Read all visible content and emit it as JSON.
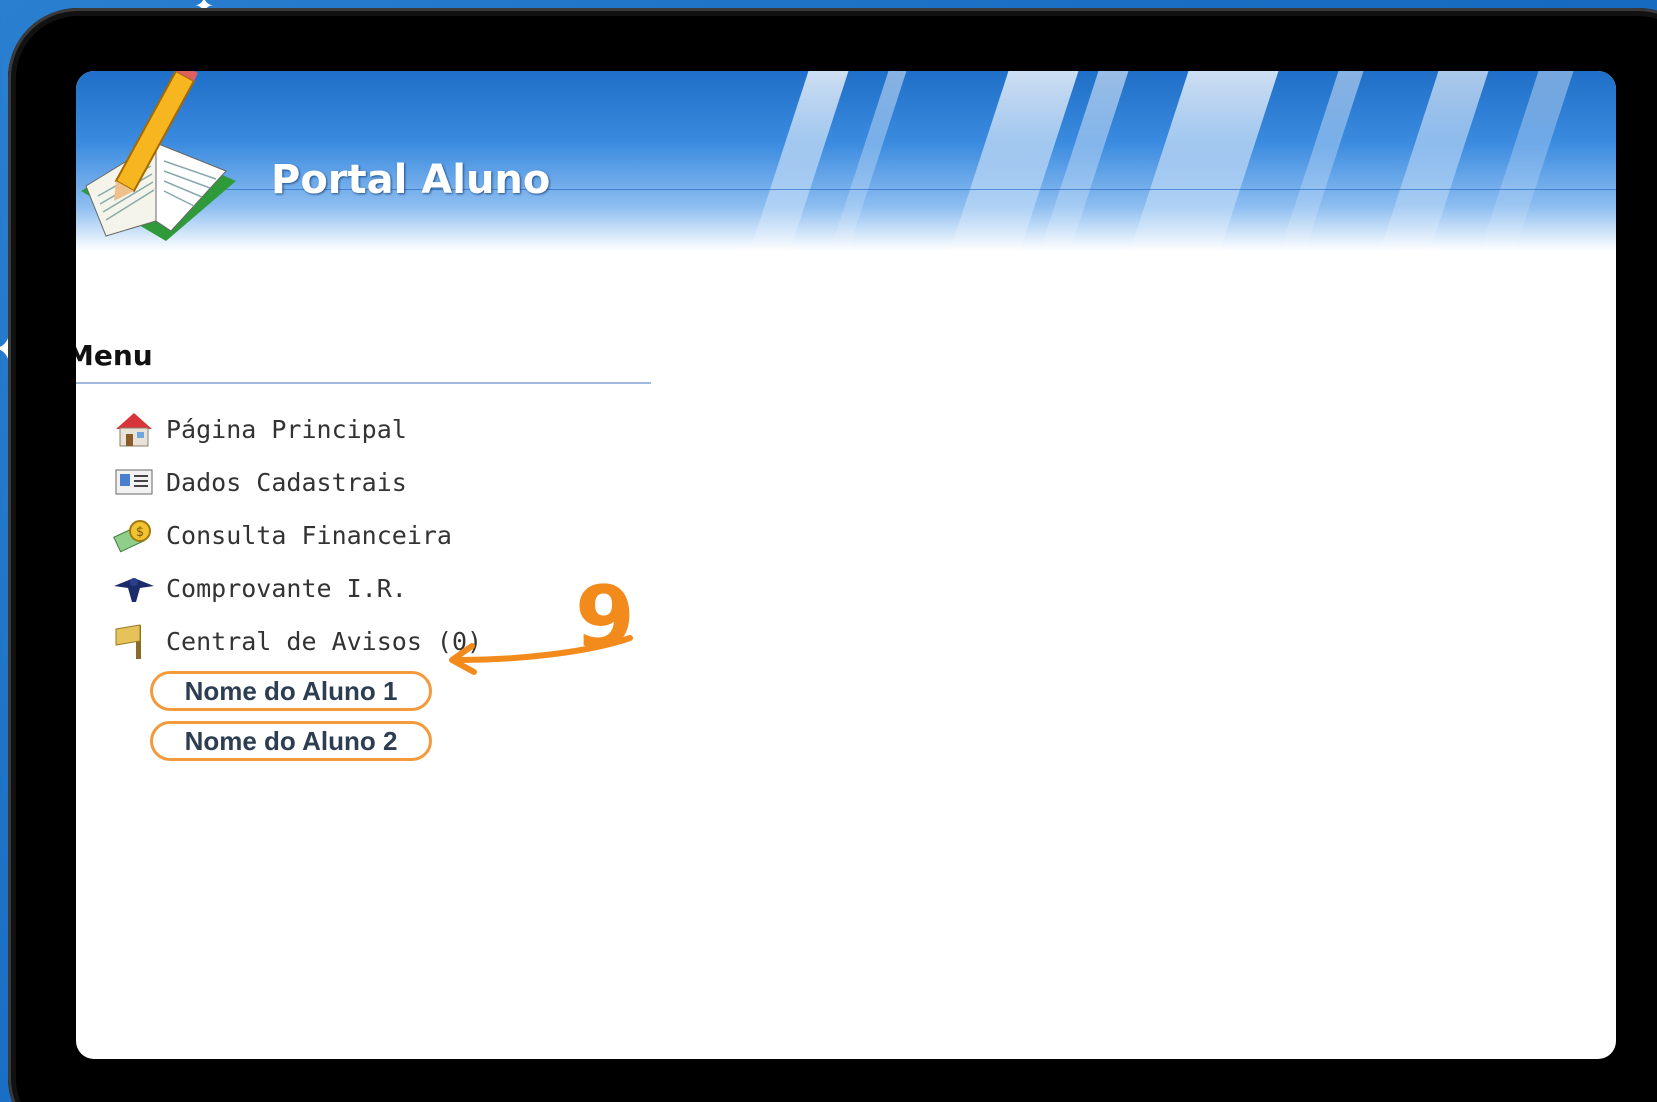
{
  "header": {
    "title": "Portal Aluno"
  },
  "menu": {
    "heading": "Menu",
    "items": [
      {
        "label": "Página Principal",
        "icon": "house-icon"
      },
      {
        "label": "Dados Cadastrais",
        "icon": "id-card-icon"
      },
      {
        "label": "Consulta Financeira",
        "icon": "money-icon"
      },
      {
        "label": "Comprovante I.R.",
        "icon": "tax-eagle-icon"
      },
      {
        "label": "Central de Avisos (0)",
        "icon": "flag-icon"
      }
    ],
    "students": [
      {
        "label": "Nome do Aluno 1"
      },
      {
        "label": "Nome do Aluno 2"
      }
    ]
  },
  "annotation": {
    "number": "9",
    "color": "#f28a1c"
  }
}
